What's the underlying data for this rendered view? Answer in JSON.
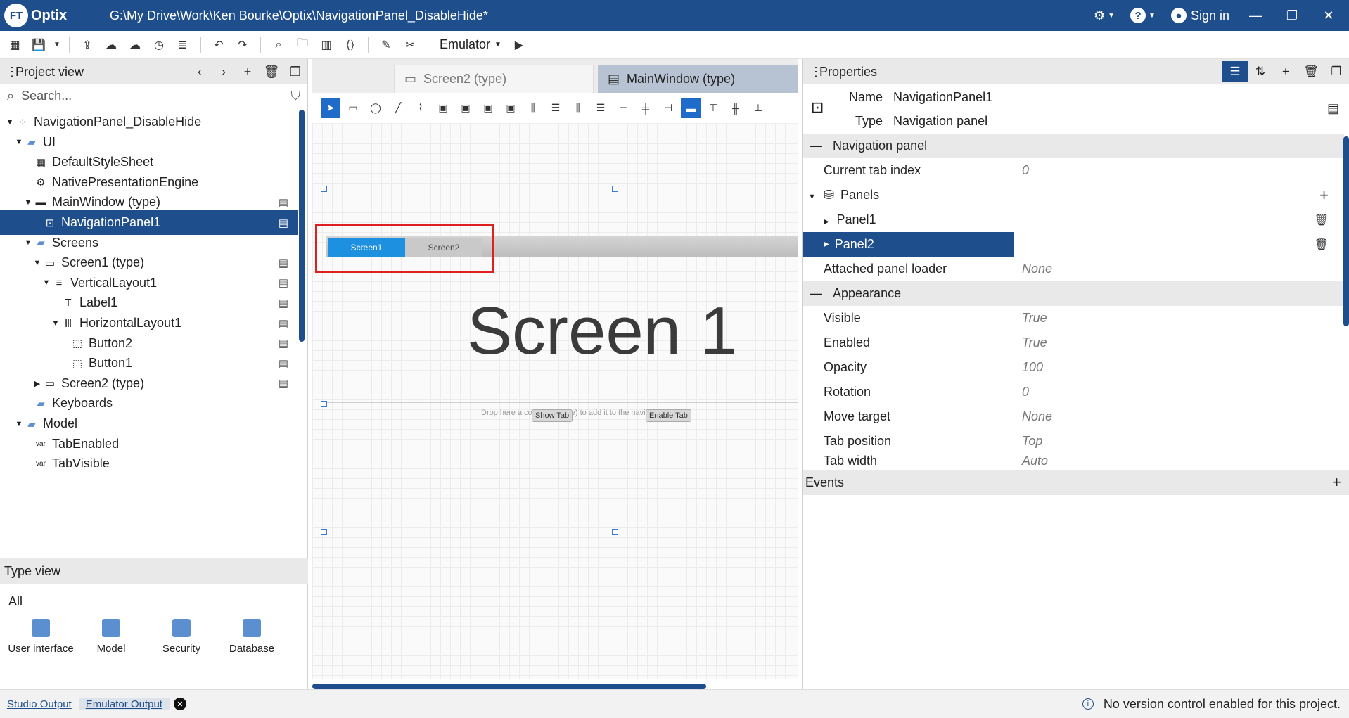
{
  "titlebar": {
    "app_name": "Optix",
    "logo_mark": "FT",
    "path": "G:\\My Drive\\Work\\Ken Bourke\\Optix\\NavigationPanel_DisableHide*",
    "sign_in": "Sign in"
  },
  "toolbar": {
    "emulator_label": "Emulator"
  },
  "project_view": {
    "title": "Project view",
    "search_placeholder": "Search...",
    "tree": [
      {
        "label": "NavigationPanel_DisableHide",
        "icon": "project-icon",
        "level": 0,
        "expanded": true
      },
      {
        "label": "UI",
        "icon": "folder-icon",
        "level": 1,
        "expanded": true
      },
      {
        "label": "DefaultStyleSheet",
        "icon": "stylesheet-icon",
        "level": 2
      },
      {
        "label": "NativePresentationEngine",
        "icon": "gear-icon",
        "level": 2
      },
      {
        "label": "MainWindow (type)",
        "icon": "window-icon",
        "level": 2,
        "expanded": true
      },
      {
        "label": "NavigationPanel1",
        "icon": "navigation-panel-icon",
        "level": 3,
        "selected": true
      },
      {
        "label": "Screens",
        "icon": "folder-icon",
        "level": 2,
        "expanded": true
      },
      {
        "label": "Screen1 (type)",
        "icon": "screen-icon",
        "level": 3,
        "expanded": true
      },
      {
        "label": "VerticalLayout1",
        "icon": "vertical-layout-icon",
        "level": 4,
        "expanded": true
      },
      {
        "label": "Label1",
        "icon": "label-icon",
        "level": 5
      },
      {
        "label": "HorizontalLayout1",
        "icon": "horizontal-layout-icon",
        "level": 5,
        "expanded": true
      },
      {
        "label": "Button2",
        "icon": "button-icon",
        "level": 6
      },
      {
        "label": "Button1",
        "icon": "button-icon",
        "level": 6
      },
      {
        "label": "Screen2 (type)",
        "icon": "screen-icon",
        "level": 3,
        "expanded": false
      },
      {
        "label": "Keyboards",
        "icon": "folder-icon",
        "level": 2
      },
      {
        "label": "Model",
        "icon": "folder-icon",
        "level": 1,
        "expanded": true
      },
      {
        "label": "TabEnabled",
        "icon": "variable-icon",
        "level": 2
      },
      {
        "label": "TabVisible",
        "icon": "variable-icon",
        "level": 2
      }
    ]
  },
  "type_view": {
    "title": "Type view",
    "filter": "All",
    "items": [
      {
        "label": "User interface"
      },
      {
        "label": "Model"
      },
      {
        "label": "Security"
      },
      {
        "label": "Database"
      }
    ]
  },
  "editor": {
    "tabs": [
      {
        "label": "Screen2 (type)",
        "active": false
      },
      {
        "label": "MainWindow (type)",
        "active": true
      }
    ],
    "nav_tabs": [
      "Screen1",
      "Screen2"
    ],
    "screen_text": "Screen 1",
    "drop_hint": "Drop here a container (type) to add it to the navigation panel",
    "buttons": [
      "Show Tab",
      "Enable Tab"
    ]
  },
  "properties": {
    "title": "Properties",
    "name_label": "Name",
    "name_value": "NavigationPanel1",
    "type_label": "Type",
    "type_value": "Navigation panel",
    "rows": [
      {
        "label": "Navigation panel",
        "group": true
      },
      {
        "label": "Current tab index",
        "value": "0"
      },
      {
        "label": "Panels",
        "value": "",
        "expanded": true
      },
      {
        "label": "Panel1",
        "value": ""
      },
      {
        "label": "Panel2",
        "value": "",
        "selected": true
      },
      {
        "label": "Attached panel loader",
        "value": "None"
      },
      {
        "label": "Appearance",
        "group": true
      },
      {
        "label": "Visible",
        "value": "True"
      },
      {
        "label": "Enabled",
        "value": "True"
      },
      {
        "label": "Opacity",
        "value": "100"
      },
      {
        "label": "Rotation",
        "value": "0"
      },
      {
        "label": "Move target",
        "value": "None"
      },
      {
        "label": "Tab position",
        "value": "Top"
      },
      {
        "label": "Tab width",
        "value": "Auto"
      }
    ],
    "events_label": "Events"
  },
  "status": {
    "tabs": [
      "Studio Output",
      "Emulator Output"
    ],
    "message": "No version control enabled for this project."
  },
  "colors": {
    "brand": "#1f4e8c",
    "nav_tab_active": "#1e90e0",
    "highlight_box": "#e02020"
  }
}
